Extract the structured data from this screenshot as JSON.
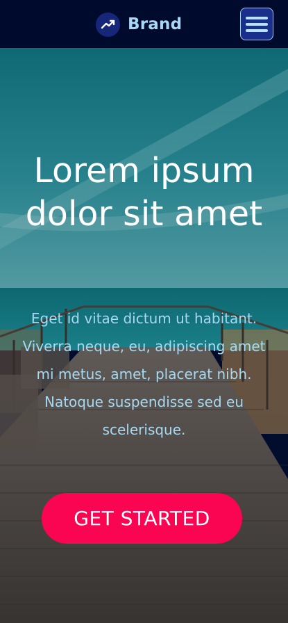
{
  "header": {
    "brand_name": "Brand",
    "logo_icon": "trending-up-icon",
    "menu_icon": "hamburger-menu-icon"
  },
  "hero": {
    "title": "Lorem ipsum dolor sit amet",
    "text": "Eget id vitae dictum ut habitant. Viverra neque, eu, adipiscing amet mi metus, amet, placerat nibh. Natoque suspendisse sed eu scelerisque.",
    "cta_label": "GET STARTED",
    "background": "seaside-boardwalk-photo"
  },
  "colors": {
    "header_bg": "#000a2d",
    "brand_text": "#a9d7f6",
    "cta_bg": "#fa0552",
    "hero_text": "#a8d9f2"
  }
}
